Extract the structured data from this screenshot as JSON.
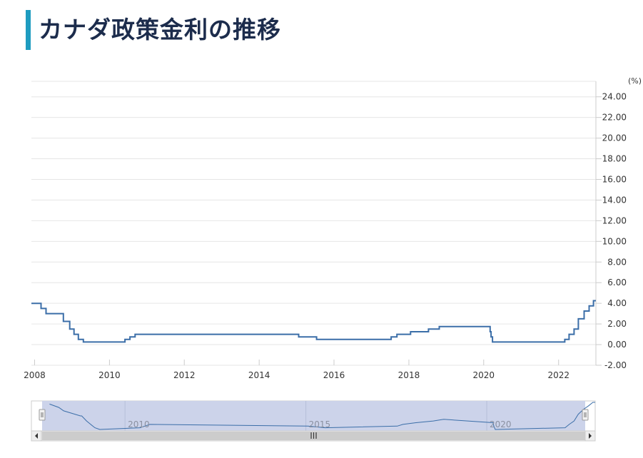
{
  "page": {
    "title": "カナダ政策金利の推移"
  },
  "chart_data": {
    "type": "line",
    "title": "カナダ政策金利の推移",
    "unit": "(%)",
    "ylim": [
      -2,
      25.5
    ],
    "yticks": [
      "24.00",
      "22.00",
      "20.00",
      "18.00",
      "16.00",
      "14.00",
      "12.00",
      "10.00",
      "8.00",
      "6.00",
      "4.00",
      "2.00",
      "0.00",
      "-2.00"
    ],
    "ytick_values": [
      24,
      22,
      20,
      18,
      16,
      14,
      12,
      10,
      8,
      6,
      4,
      2,
      0,
      -2
    ],
    "xlim": [
      "2007-12-01",
      "2022-12-31"
    ],
    "xticks": [
      "2008",
      "2010",
      "2012",
      "2014",
      "2016",
      "2018",
      "2020",
      "2022"
    ],
    "grid": true,
    "series": [
      {
        "color": "#3b6ea8",
        "x": [
          "2007-12-01",
          "2008-03-04",
          "2008-04-22",
          "2008-10-08",
          "2008-10-21",
          "2008-12-09",
          "2009-01-20",
          "2009-03-03",
          "2009-04-21",
          "2010-06-01",
          "2010-07-20",
          "2010-09-08",
          "2015-01-21",
          "2015-07-15",
          "2017-07-12",
          "2017-09-06",
          "2018-01-17",
          "2018-07-11",
          "2018-10-24",
          "2020-03-04",
          "2020-03-13",
          "2020-03-27",
          "2022-03-02",
          "2022-04-13",
          "2022-06-01",
          "2022-07-13",
          "2022-09-07",
          "2022-10-26",
          "2022-12-07",
          "2022-12-31"
        ],
        "y": [
          4.0,
          3.5,
          3.0,
          2.25,
          2.25,
          1.5,
          1.0,
          0.5,
          0.25,
          0.5,
          0.75,
          1.0,
          0.75,
          0.5,
          0.75,
          1.0,
          1.25,
          1.5,
          1.75,
          1.25,
          0.75,
          0.25,
          0.5,
          1.0,
          1.5,
          2.5,
          3.25,
          3.75,
          4.25,
          4.25
        ]
      }
    ],
    "navigator": {
      "labels": [
        "2010",
        "2015",
        "2020"
      ],
      "label_years": [
        2010,
        2015,
        2020
      ],
      "xlim": [
        "2007-06-01",
        "2022-12-31"
      ],
      "scroll_label": "III"
    }
  }
}
